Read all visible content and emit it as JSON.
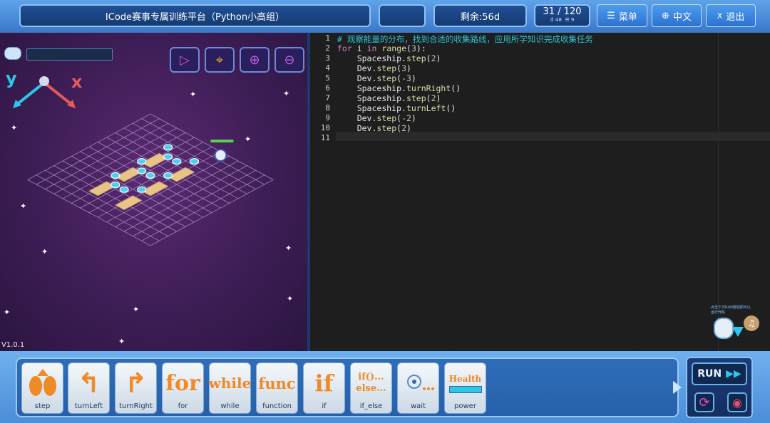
{
  "header": {
    "title": "ICode赛事专属训练平台（Python小高组）",
    "remaining": "剩余:56d",
    "progress": "31 / 120",
    "stat_a": "48",
    "stat_b": "9",
    "menu_label": "菜单",
    "lang_label": "中文",
    "exit_label": "退出",
    "exit_icon_text": "X"
  },
  "game": {
    "version": "V1.0.1",
    "axis_y": "y",
    "axis_x": "x"
  },
  "code": {
    "line_numbers": [
      "1",
      "2",
      "3",
      "4",
      "5",
      "6",
      "7",
      "8",
      "9",
      "10",
      "11"
    ],
    "lines": [
      "# 观察能量的分布，找到合适的收集路线，应用所学知识完成收集任务",
      "for i in range(3):",
      "    Spaceship.step(2)",
      "    Dev.step(3)",
      "    Dev.step(-3)",
      "    Spaceship.turnRight()",
      "    Spaceship.step(2)",
      "    Spaceship.turnLeft()",
      "    Dev.step(-2)",
      "    Dev.step(2)",
      ""
    ],
    "hint": "点击下方RUN按钮即可以运行代码"
  },
  "blocks": {
    "items": [
      {
        "label": "step"
      },
      {
        "label": "turnLeft"
      },
      {
        "label": "turnRight"
      },
      {
        "label": "for",
        "icon_text": "for"
      },
      {
        "label": "while",
        "icon_text": "while"
      },
      {
        "label": "function",
        "icon_text": "func"
      },
      {
        "label": "if",
        "icon_text": "if"
      },
      {
        "label": "if_else",
        "icon_text": "if()..."
      },
      {
        "label": "wait"
      },
      {
        "label": "power",
        "icon_text": "Health"
      }
    ],
    "ifelse_line2": "else..."
  },
  "run": {
    "label": "RUN"
  },
  "colors": {
    "keyword": "#569cd6",
    "comment": "#2ec4d6",
    "function": "#dcdcaa",
    "number": "#b5cea8",
    "accent_orange": "#f08a26"
  }
}
